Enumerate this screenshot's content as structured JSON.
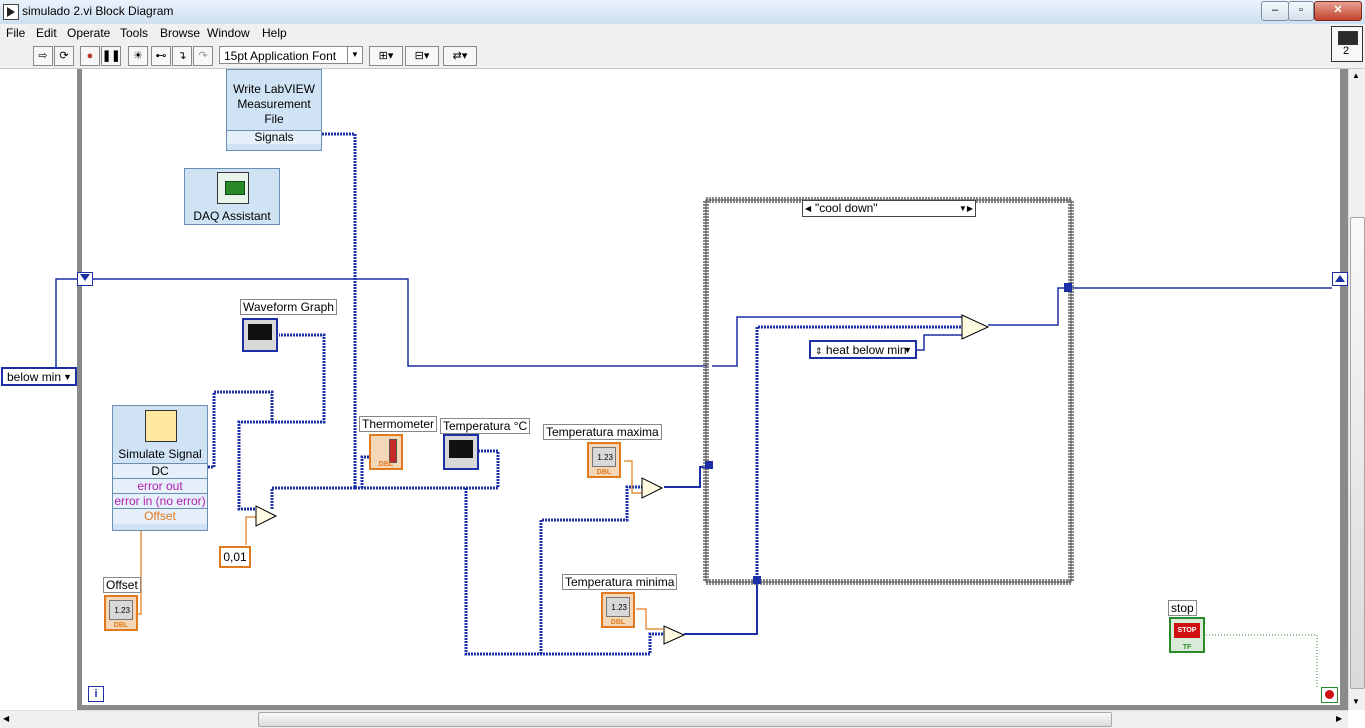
{
  "window": {
    "title": "simulado 2.vi Block Diagram",
    "min": "‒",
    "max": "▫",
    "close": "✕"
  },
  "menu": [
    "File",
    "Edit",
    "Operate",
    "Tools",
    "Browse",
    "Window",
    "Help"
  ],
  "toolbar": {
    "font": "15pt Application Font",
    "help": "?",
    "conn_num": "2"
  },
  "nodes": {
    "write_file": {
      "line1": "Write LabVIEW",
      "line2": "Measurement",
      "line3": "File",
      "signals": "Signals"
    },
    "daq": {
      "label": "DAQ Assistant"
    },
    "sim": {
      "title": "Simulate Signal",
      "dc": "DC",
      "err_out": "error out",
      "err_in": "error in (no error)",
      "offset": "Offset"
    },
    "waveform_graph": "Waveform Graph",
    "thermometer": "Thermometer",
    "temperatura_c": "Temperatura °C",
    "temp_max": "Temperatura maxima",
    "temp_min": "Temperatura minima",
    "offset": "Offset",
    "const": "0,01",
    "below_min": "below min",
    "case_selector": "\"cool down\"",
    "heat_below": "heat below min",
    "stop": "stop",
    "stop_btn": "STOP",
    "dbl": "DBL",
    "num": "1.23",
    "tf": "TF",
    "iter": "i"
  },
  "colors": {
    "wire_numeric": "#e07a1f",
    "wire_dynamic": "#1c2fa5",
    "enum": "#1c2fa5",
    "bool": "#2a8a2a"
  }
}
